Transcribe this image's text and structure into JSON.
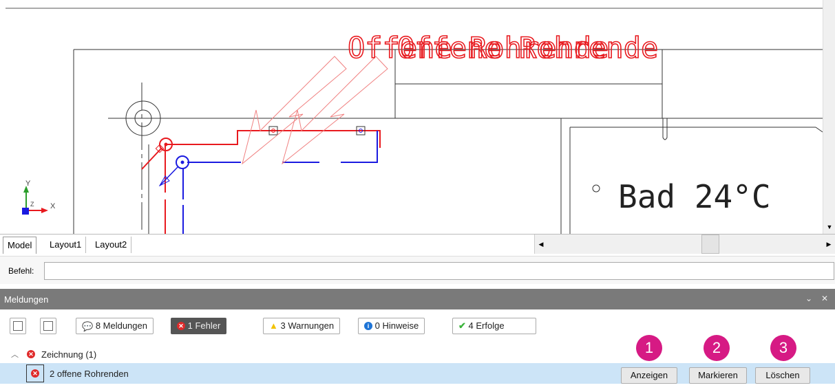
{
  "drawing": {
    "annotation_text": "Offene Rohrende",
    "room_label": "Bad 24°C",
    "ucs_y": "Y",
    "ucs_x": "X",
    "ucs_z": "Z"
  },
  "tabs": [
    "Model",
    "Layout1",
    "Layout2"
  ],
  "command": {
    "label": "Befehl:",
    "value": ""
  },
  "panel": {
    "title": "Meldungen",
    "filters": {
      "messages": "8 Meldungen",
      "errors": "1 Fehler",
      "warnings": "3 Warnungen",
      "hints": "0 Hinweise",
      "successes": "4 Erfolge"
    },
    "group": {
      "label": "Zeichnung (1)"
    },
    "item": {
      "label": "2 offene Rohrenden"
    },
    "actions": {
      "show": "Anzeigen",
      "mark": "Markieren",
      "delete": "Löschen"
    },
    "markers": [
      "1",
      "2",
      "3"
    ]
  },
  "colors": {
    "error": "#e02a2a",
    "warning": "#f2c200",
    "info": "#1e74d6",
    "success": "#3bb43b",
    "marker": "#d61a84",
    "selection": "#cce4f7"
  }
}
